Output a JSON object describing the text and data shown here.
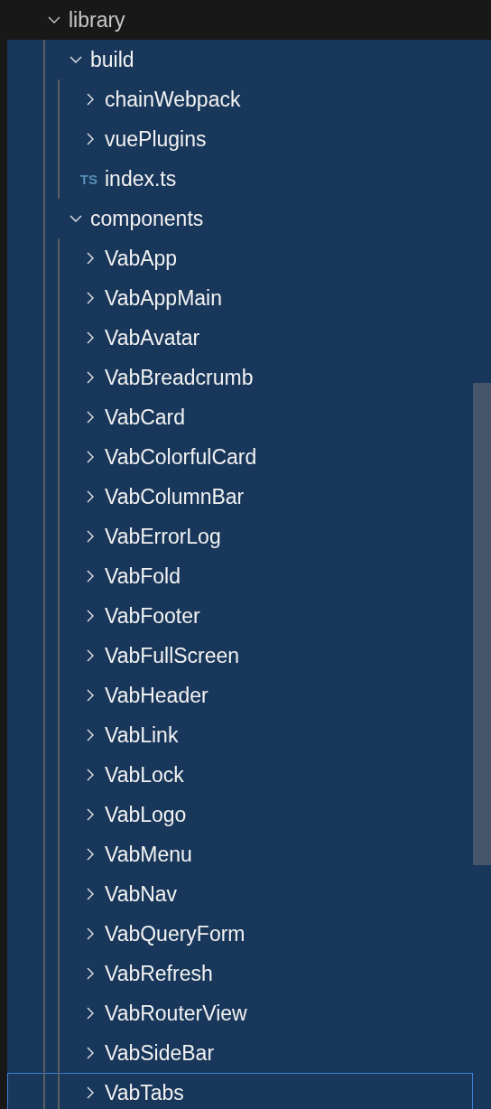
{
  "tree": [
    {
      "name": "library",
      "kind": "folder",
      "expanded": true,
      "selected": false,
      "focused": false,
      "children": [
        {
          "name": "build",
          "kind": "folder",
          "expanded": true,
          "selected": true,
          "focused": false,
          "children": [
            {
              "name": "chainWebpack",
              "kind": "folder",
              "expanded": false,
              "selected": true,
              "focused": false
            },
            {
              "name": "vuePlugins",
              "kind": "folder",
              "expanded": false,
              "selected": true,
              "focused": false
            },
            {
              "name": "index.ts",
              "kind": "file",
              "badge": "TS",
              "selected": true,
              "focused": false
            }
          ]
        },
        {
          "name": "components",
          "kind": "folder",
          "expanded": true,
          "selected": true,
          "focused": false,
          "children": [
            {
              "name": "VabApp",
              "kind": "folder",
              "expanded": false,
              "selected": true,
              "focused": false
            },
            {
              "name": "VabAppMain",
              "kind": "folder",
              "expanded": false,
              "selected": true,
              "focused": false
            },
            {
              "name": "VabAvatar",
              "kind": "folder",
              "expanded": false,
              "selected": true,
              "focused": false
            },
            {
              "name": "VabBreadcrumb",
              "kind": "folder",
              "expanded": false,
              "selected": true,
              "focused": false
            },
            {
              "name": "VabCard",
              "kind": "folder",
              "expanded": false,
              "selected": true,
              "focused": false
            },
            {
              "name": "VabColorfulCard",
              "kind": "folder",
              "expanded": false,
              "selected": true,
              "focused": false
            },
            {
              "name": "VabColumnBar",
              "kind": "folder",
              "expanded": false,
              "selected": true,
              "focused": false
            },
            {
              "name": "VabErrorLog",
              "kind": "folder",
              "expanded": false,
              "selected": true,
              "focused": false
            },
            {
              "name": "VabFold",
              "kind": "folder",
              "expanded": false,
              "selected": true,
              "focused": false
            },
            {
              "name": "VabFooter",
              "kind": "folder",
              "expanded": false,
              "selected": true,
              "focused": false
            },
            {
              "name": "VabFullScreen",
              "kind": "folder",
              "expanded": false,
              "selected": true,
              "focused": false
            },
            {
              "name": "VabHeader",
              "kind": "folder",
              "expanded": false,
              "selected": true,
              "focused": false
            },
            {
              "name": "VabLink",
              "kind": "folder",
              "expanded": false,
              "selected": true,
              "focused": false
            },
            {
              "name": "VabLock",
              "kind": "folder",
              "expanded": false,
              "selected": true,
              "focused": false
            },
            {
              "name": "VabLogo",
              "kind": "folder",
              "expanded": false,
              "selected": true,
              "focused": false
            },
            {
              "name": "VabMenu",
              "kind": "folder",
              "expanded": false,
              "selected": true,
              "focused": false
            },
            {
              "name": "VabNav",
              "kind": "folder",
              "expanded": false,
              "selected": true,
              "focused": false
            },
            {
              "name": "VabQueryForm",
              "kind": "folder",
              "expanded": false,
              "selected": true,
              "focused": false
            },
            {
              "name": "VabRefresh",
              "kind": "folder",
              "expanded": false,
              "selected": true,
              "focused": false
            },
            {
              "name": "VabRouterView",
              "kind": "folder",
              "expanded": false,
              "selected": true,
              "focused": false
            },
            {
              "name": "VabSideBar",
              "kind": "folder",
              "expanded": false,
              "selected": true,
              "focused": false
            },
            {
              "name": "VabTabs",
              "kind": "folder",
              "expanded": false,
              "selected": true,
              "focused": true
            }
          ]
        }
      ]
    }
  ]
}
